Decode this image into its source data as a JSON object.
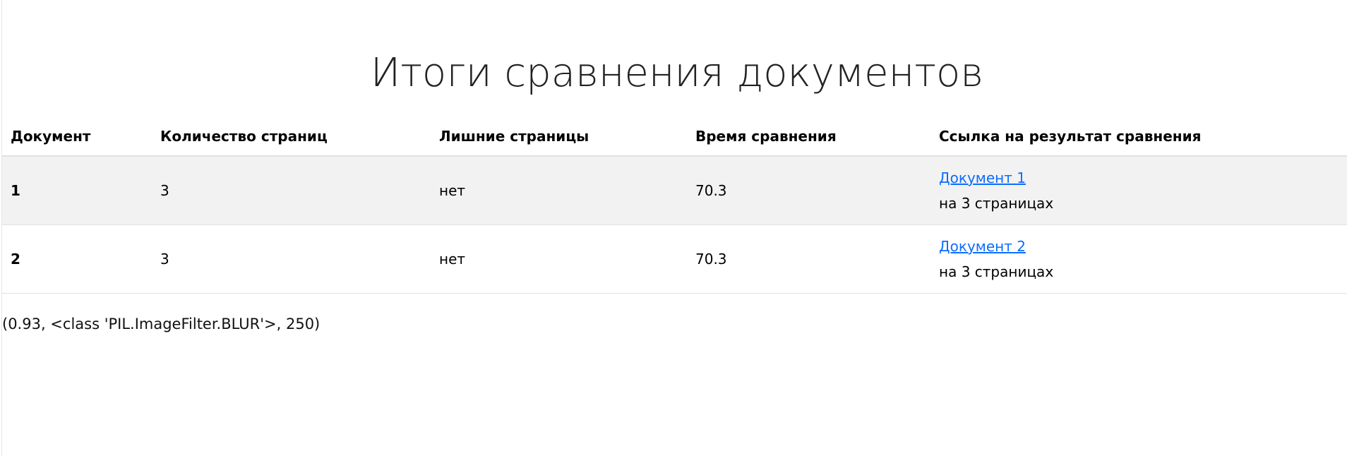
{
  "page": {
    "title": "Итоги сравнения документов",
    "debug_text": "(0.93, <class 'PIL.ImageFilter.BLUR'>, 250)"
  },
  "table": {
    "headers": [
      "Документ",
      "Количество страниц",
      "Лишние страницы",
      "Время сравнения",
      "Ссылка на результат сравнения"
    ],
    "rows": [
      {
        "document": "1",
        "page_count": "3",
        "extra_pages": "нет",
        "compare_time": "70.3",
        "link_label": "Документ 1",
        "link_note": "на 3 страницах"
      },
      {
        "document": "2",
        "page_count": "3",
        "extra_pages": "нет",
        "compare_time": "70.3",
        "link_label": "Документ 2",
        "link_note": "на 3 страницах"
      }
    ]
  },
  "colors": {
    "link": "#0d6efd",
    "stripe": "#f2f2f2",
    "border": "#dee2e6"
  }
}
